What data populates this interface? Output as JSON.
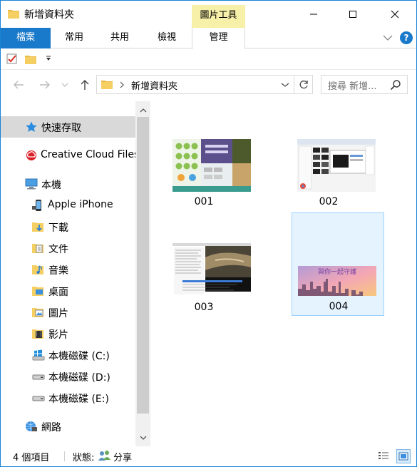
{
  "window": {
    "title": "新增資料夾",
    "context_tab_group": "圖片工具"
  },
  "ribbon": {
    "tabs": [
      {
        "label": "檔案"
      },
      {
        "label": "常用"
      },
      {
        "label": "共用"
      },
      {
        "label": "檢視"
      },
      {
        "label": "管理"
      }
    ],
    "help": "?"
  },
  "address_bar": {
    "path": "新增資料夾",
    "search_placeholder": "搜尋 新增..."
  },
  "nav_pane": {
    "items": [
      {
        "label": "快速存取",
        "icon": "star-icon"
      },
      {
        "label": "Creative Cloud Files",
        "icon": "creative-cloud-icon"
      },
      {
        "label": "本機",
        "icon": "computer-icon"
      },
      {
        "label": "Apple iPhone",
        "icon": "iphone-icon"
      },
      {
        "label": "下載",
        "icon": "downloads-icon"
      },
      {
        "label": "文件",
        "icon": "documents-icon"
      },
      {
        "label": "音樂",
        "icon": "music-icon"
      },
      {
        "label": "桌面",
        "icon": "desktop-icon"
      },
      {
        "label": "圖片",
        "icon": "pictures-icon"
      },
      {
        "label": "影片",
        "icon": "videos-icon"
      },
      {
        "label": "本機磁碟 (C:)",
        "icon": "windows-drive-icon"
      },
      {
        "label": "本機磁碟 (D:)",
        "icon": "drive-icon"
      },
      {
        "label": "本機磁碟 (E:)",
        "icon": "drive-icon"
      },
      {
        "label": "網路",
        "icon": "network-icon"
      }
    ]
  },
  "files": [
    {
      "name": "001"
    },
    {
      "name": "002"
    },
    {
      "name": "003"
    },
    {
      "name": "004",
      "banner_text": "與你一起守護"
    }
  ],
  "status_bar": {
    "count": "4 個項目",
    "state_label": "狀態:",
    "state_value": "分享"
  },
  "colors": {
    "accent": "#1979ca",
    "context_tab": "#f7f0a8",
    "selection_fill": "#e5f3ff",
    "selection_border": "#99d1ff"
  }
}
